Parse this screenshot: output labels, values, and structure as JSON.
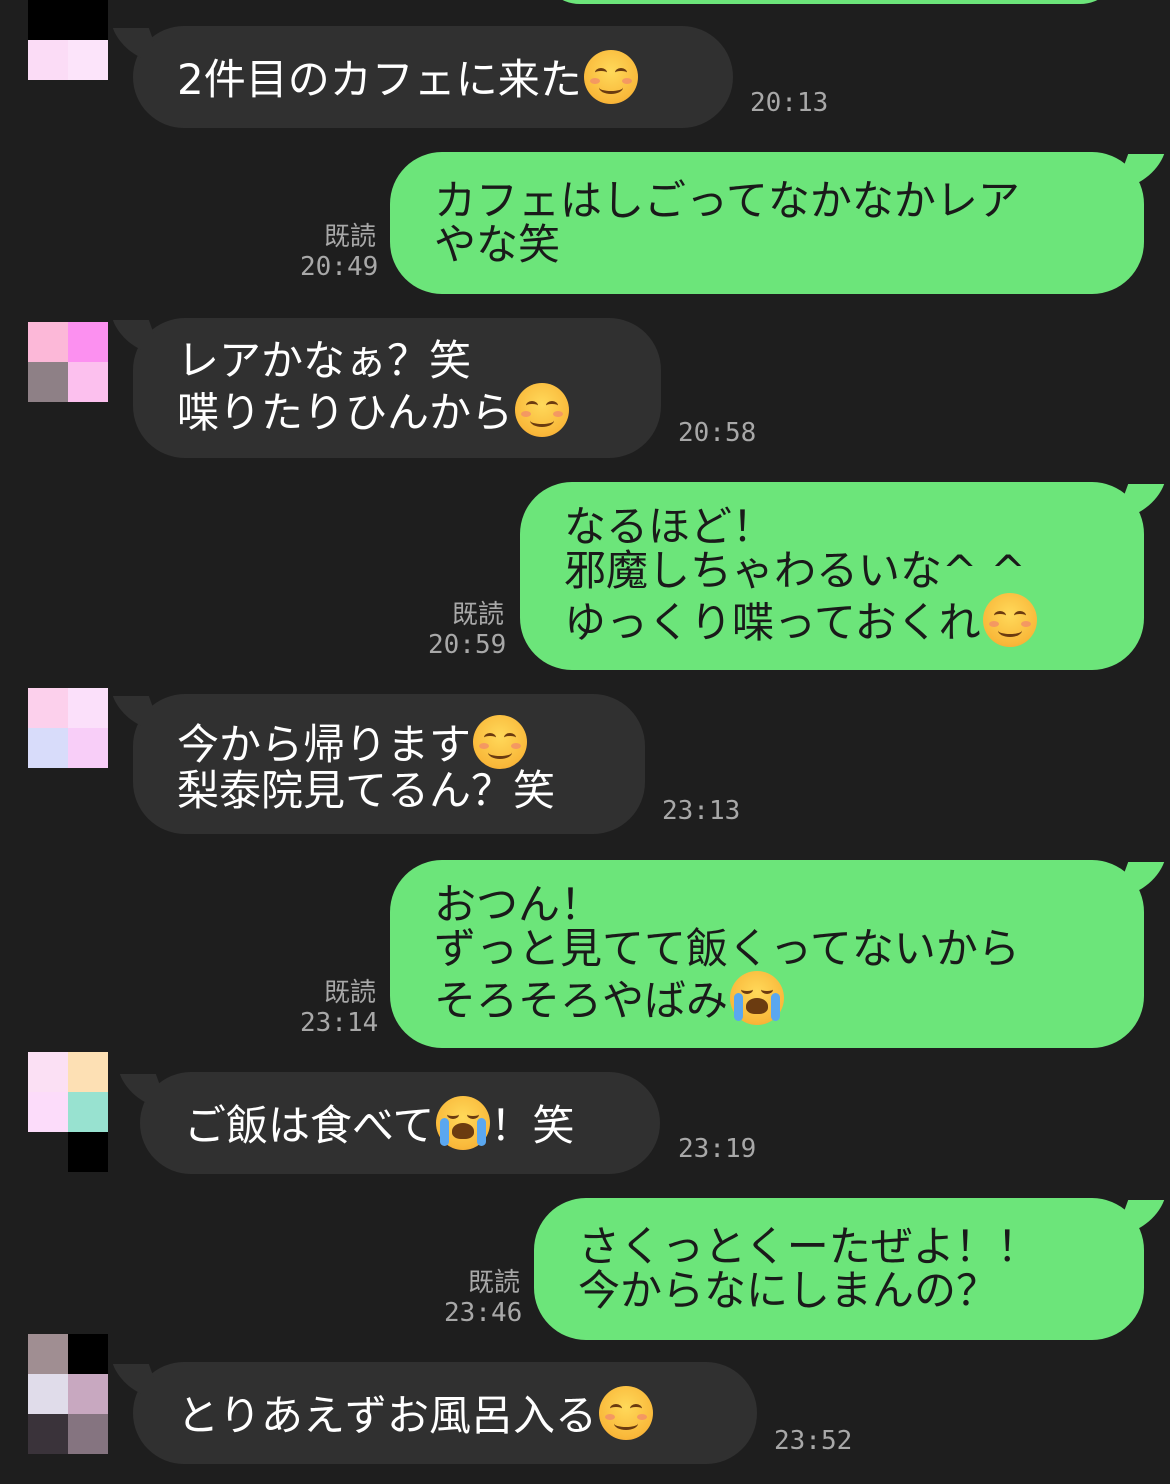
{
  "colors": {
    "background": "#1e1e1e",
    "incoming_bubble": "#303030",
    "outgoing_bubble": "#6ce57a",
    "meta_text": "#a8a8a8"
  },
  "messages": [
    {
      "dir": "in",
      "lines": [
        "2件目のカフェに来た"
      ],
      "emoji": "smiling-face-icon",
      "time": "20:13"
    },
    {
      "dir": "out",
      "read": "既読",
      "lines": [
        "カフェはしごってなかなかレア",
        "やな笑"
      ],
      "time": "20:49"
    },
    {
      "dir": "in",
      "lines": [
        "レアかなぁ？笑",
        "喋りたりひんから"
      ],
      "emoji": "smiling-face-icon",
      "time": "20:58"
    },
    {
      "dir": "out",
      "read": "既読",
      "lines": [
        "なるほど！",
        "邪魔しちゃわるいな^ ^",
        "ゆっくり喋っておくれ"
      ],
      "emoji": "smiling-face-icon",
      "time": "20:59"
    },
    {
      "dir": "in",
      "lines": [
        "今から帰ります",
        "梨泰院見てるん？笑"
      ],
      "emoji": "smiling-face-icon",
      "time": "23:13"
    },
    {
      "dir": "out",
      "read": "既読",
      "lines": [
        "おつん！",
        "ずっと見てて飯くってないから",
        "そろそろやばみ"
      ],
      "emoji": "crying-face-icon",
      "time": "23:14"
    },
    {
      "dir": "in",
      "lines": [
        "ご飯は食べて",
        "！笑"
      ],
      "emoji": "crying-face-icon",
      "time": "23:19"
    },
    {
      "dir": "out",
      "read": "既読",
      "lines": [
        "さくっとくーたぜよ！！",
        "今からなにしまんの？"
      ],
      "time": "23:46"
    },
    {
      "dir": "in",
      "lines": [
        "とりあえずお風呂入る"
      ],
      "emoji": "smiling-face-icon",
      "time": "23:52"
    }
  ]
}
